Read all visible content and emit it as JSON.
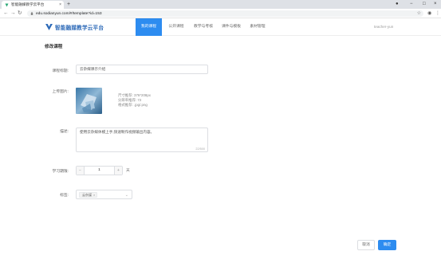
{
  "browser": {
    "tab_title": "智能融媒教学云平台",
    "tab_close": "×",
    "new_tab": "+",
    "url": "edu.sodianyun.com/#/template?id=153",
    "star": "☆"
  },
  "app": {
    "brand": "智能融媒教学云平台",
    "nav": [
      {
        "label": "我的课程",
        "active": true
      },
      {
        "label": "公开课程",
        "active": false
      },
      {
        "label": "教学与考核",
        "active": false
      },
      {
        "label": "课件与模板",
        "active": false
      },
      {
        "label": "素材管理",
        "active": false
      }
    ],
    "user": "teacher-yun"
  },
  "form": {
    "title": "修改课程",
    "course_title_label": "课程标题:",
    "course_title_value": "云杂媒课示介绍",
    "upload_label": "上传图片:",
    "hint_size": "尺寸推荐: 376*208px",
    "hint_res": "分辨率推荐: 72",
    "hint_format": "格式推荐: .jpg/.png",
    "desc_label": "描述:",
    "desc_value": "使用云杂媒体模上手,快速制作视频输出内容。",
    "desc_counter": "22/500",
    "duration_label": "学习期限:",
    "duration_value": "1",
    "duration_minus": "−",
    "duration_plus": "+",
    "duration_unit": "天",
    "tags_label": "标签:",
    "tag_value": "云杂媒",
    "tag_close": "×",
    "chevron": "⌄"
  },
  "actions": {
    "cancel": "取消",
    "confirm": "确定"
  },
  "colors": {
    "accent": "#2d8cf0",
    "brand": "#2d6ab8"
  }
}
